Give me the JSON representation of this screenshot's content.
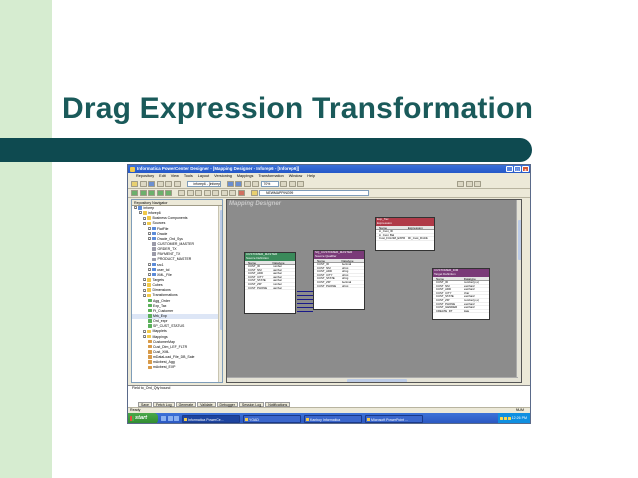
{
  "slide": {
    "title": "Drag Expression Transformation"
  },
  "window": {
    "title": "Informatica PowerCenter Designer - [Mapping Designer - Inforep6 - [Inforep6]]",
    "controls": [
      "_",
      "□",
      "x"
    ]
  },
  "menu": [
    "Repository",
    "Edit",
    "View",
    "Tools",
    "Layout",
    "Versioning",
    "Mappings",
    "Transformation",
    "Window",
    "Help"
  ],
  "toolbar": {
    "repo_combo": "inforep6 - [inforep6]",
    "zoom": "70%",
    "mapping_combo": "NEWMAPPING99"
  },
  "navigator": {
    "title": "Repository Navigator",
    "items": [
      {
        "label": "inforep",
        "indent": 0,
        "icon": "db"
      },
      {
        "label": "inforep6",
        "indent": 1,
        "icon": "folder"
      },
      {
        "label": "Business Components",
        "indent": 2,
        "icon": "folder"
      },
      {
        "label": "Sources",
        "indent": 2,
        "icon": "folder"
      },
      {
        "label": "FlatFile",
        "indent": 3,
        "icon": "db"
      },
      {
        "label": "Oracle",
        "indent": 3,
        "icon": "db"
      },
      {
        "label": "Oracle_Ord_Sys",
        "indent": 3,
        "icon": "db"
      },
      {
        "label": "CUSTOMER_MASTER",
        "indent": 4,
        "icon": "tbl"
      },
      {
        "label": "ORDER_TX",
        "indent": 4,
        "icon": "tbl"
      },
      {
        "label": "PAYMENT_TX",
        "indent": 4,
        "icon": "tbl"
      },
      {
        "label": "PRODUCT_MASTER",
        "indent": 4,
        "icon": "tbl"
      },
      {
        "label": "src1",
        "indent": 3,
        "icon": "db"
      },
      {
        "label": "user_tol",
        "indent": 3,
        "icon": "db"
      },
      {
        "label": "XML_File",
        "indent": 3,
        "icon": "db"
      },
      {
        "label": "Targets",
        "indent": 2,
        "icon": "folder"
      },
      {
        "label": "Cubes",
        "indent": 2,
        "icon": "folder"
      },
      {
        "label": "Dimensions",
        "indent": 2,
        "icon": "folder"
      },
      {
        "label": "Transformations",
        "indent": 2,
        "icon": "folder"
      },
      {
        "label": "Agg_Order",
        "indent": 3,
        "icon": "tx"
      },
      {
        "label": "Exp_Tax",
        "indent": 3,
        "icon": "tx"
      },
      {
        "label": "Ft_Customer",
        "indent": 3,
        "icon": "tx"
      },
      {
        "label": "Mrk_Exp",
        "indent": 3,
        "icon": "tx",
        "selected": true
      },
      {
        "label": "Ord_expr",
        "indent": 3,
        "icon": "tx"
      },
      {
        "label": "SP_CUST_STATUS",
        "indent": 3,
        "icon": "tx"
      },
      {
        "label": "Mapplets",
        "indent": 2,
        "icon": "folder"
      },
      {
        "label": "Mappings",
        "indent": 2,
        "icon": "folder"
      },
      {
        "label": "CustomerMap",
        "indent": 3,
        "icon": "map"
      },
      {
        "label": "Cust_Dim_LEF_FLTR",
        "indent": 3,
        "icon": "map"
      },
      {
        "label": "Cust_XML",
        "indent": 3,
        "icon": "map"
      },
      {
        "label": "mDataLoad_File_DB_Sale",
        "indent": 3,
        "icon": "map"
      },
      {
        "label": "mAvbest_Agg",
        "indent": 3,
        "icon": "map"
      },
      {
        "label": "mAvbest_EXP",
        "indent": 3,
        "icon": "map"
      }
    ]
  },
  "workspace": {
    "label": "Mapping Designer",
    "boxes": [
      {
        "id": "box-source",
        "title": "CUSTOMER_MASTER",
        "subtitle": "Source Definition",
        "color": "green",
        "cols": [
          "Name",
          "Datatype"
        ],
        "rows": [
          [
            "CUST_ID",
            "number"
          ],
          [
            "CUST_NM",
            "varchar"
          ],
          [
            "CUST_ADD",
            "varchar"
          ],
          [
            "CUST_CITY",
            "varchar"
          ],
          [
            "CUST_STATE",
            "varchar"
          ],
          [
            "CUST_ZIP",
            "number"
          ],
          [
            "CUST_PHONE",
            "varchar"
          ]
        ]
      },
      {
        "id": "box-sq",
        "title": "SQ_CUSTOMER_MASTER",
        "subtitle": "Source Qualifier",
        "color": "purple",
        "cols": [
          "Name",
          "Datatype"
        ],
        "rows": [
          [
            "CUST_ID",
            "decimal"
          ],
          [
            "CUST_NM",
            "string"
          ],
          [
            "CUST_ADD",
            "string"
          ],
          [
            "CUST_CITY",
            "string"
          ],
          [
            "CUST_STATE",
            "string"
          ],
          [
            "CUST_ZIP",
            "decimal"
          ],
          [
            "CUST_PHONE",
            "string"
          ]
        ]
      },
      {
        "id": "box-exp",
        "title": "Exp_Tax",
        "subtitle": "Expression",
        "color": "red",
        "cols": [
          "Name",
          "Expression"
        ],
        "rows": [
          [
            "in_Cust_ID",
            ""
          ],
          [
            "in_Cust_Bal",
            ""
          ],
          [
            "Cust_FULNM_EXPR",
            "IIF_Cust_RmNk"
          ]
        ]
      },
      {
        "id": "box-target",
        "title": "CUSTOMER_DIM",
        "subtitle": "Target Definition",
        "color": "purple",
        "cols": [
          "Name",
          "Datatype"
        ],
        "rows": [
          [
            "CUST_ID",
            "number(p,s)"
          ],
          [
            "CUST_NM",
            "varchar2"
          ],
          [
            "CUST_ADD",
            "varchar2"
          ],
          [
            "CUST_CITY",
            "char"
          ],
          [
            "CUST_STATE",
            "varchar2"
          ],
          [
            "CUST_ZIP",
            "number(p,s)"
          ],
          [
            "CUST_PHONE",
            "varchar2"
          ],
          [
            "CUST_GENDER",
            "varchar2"
          ],
          [
            "CREATE_DT",
            "date"
          ]
        ]
      }
    ]
  },
  "output": {
    "message": "Field to_Ord_Qty bound",
    "tabs": [
      "Save",
      "Fetch Log",
      "Generate",
      "Validate",
      "Debugger",
      "Session Log",
      "Notifications"
    ]
  },
  "status": {
    "left": "Ready",
    "right": "NUM"
  },
  "taskbar": {
    "start": "start",
    "tasks": [
      "Informatica PowerCe...",
      "YOAD",
      "Kanboy Informatica",
      "Microsoft PowerPoint ..."
    ],
    "clock": "12:26 PM"
  }
}
